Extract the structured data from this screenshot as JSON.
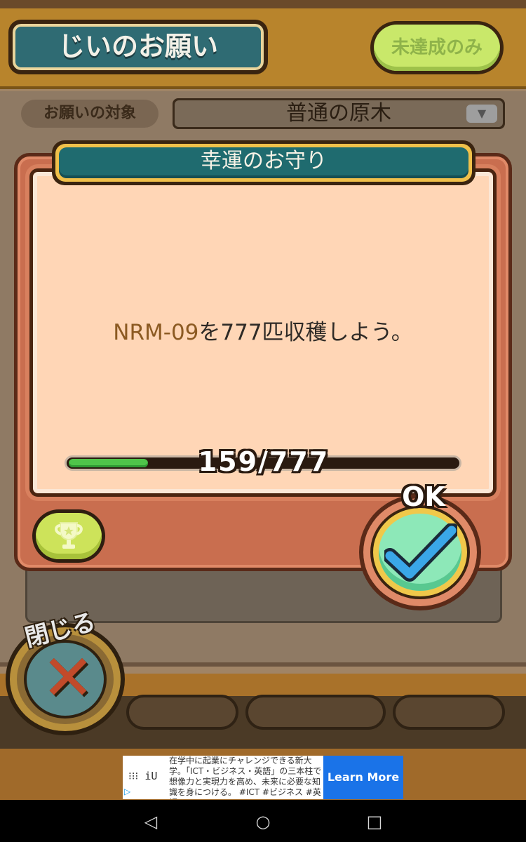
{
  "background": {
    "screen_title": "じいのお願い",
    "filter_button": "未達成のみ",
    "target_label": "お願いの対象",
    "target_value": "普通の原木"
  },
  "dialog": {
    "title": "幸運のお守り",
    "mission_target": "NRM-09",
    "mission_rest": "を777匹収穫しよう。",
    "progress_text": "159/777",
    "progress_fraction": 0.2046,
    "ok_label": "OK"
  },
  "close_button": {
    "label": "閉じる"
  },
  "ad": {
    "logo": "iU",
    "text": "在学中に起業にチャレンジできる新大学。「ICT・ビジネス・英語」の三本柱で想像力と実現力を高め、未来に必要な知識を身につける。 #ICT #ビジネス #英語",
    "cta": "Learn More"
  },
  "colors": {
    "accent_teal": "#1f6b6f",
    "progress_green": "#4fc44a",
    "ad_blue": "#1a73e8",
    "mission_highlight": "#8c5a22"
  }
}
